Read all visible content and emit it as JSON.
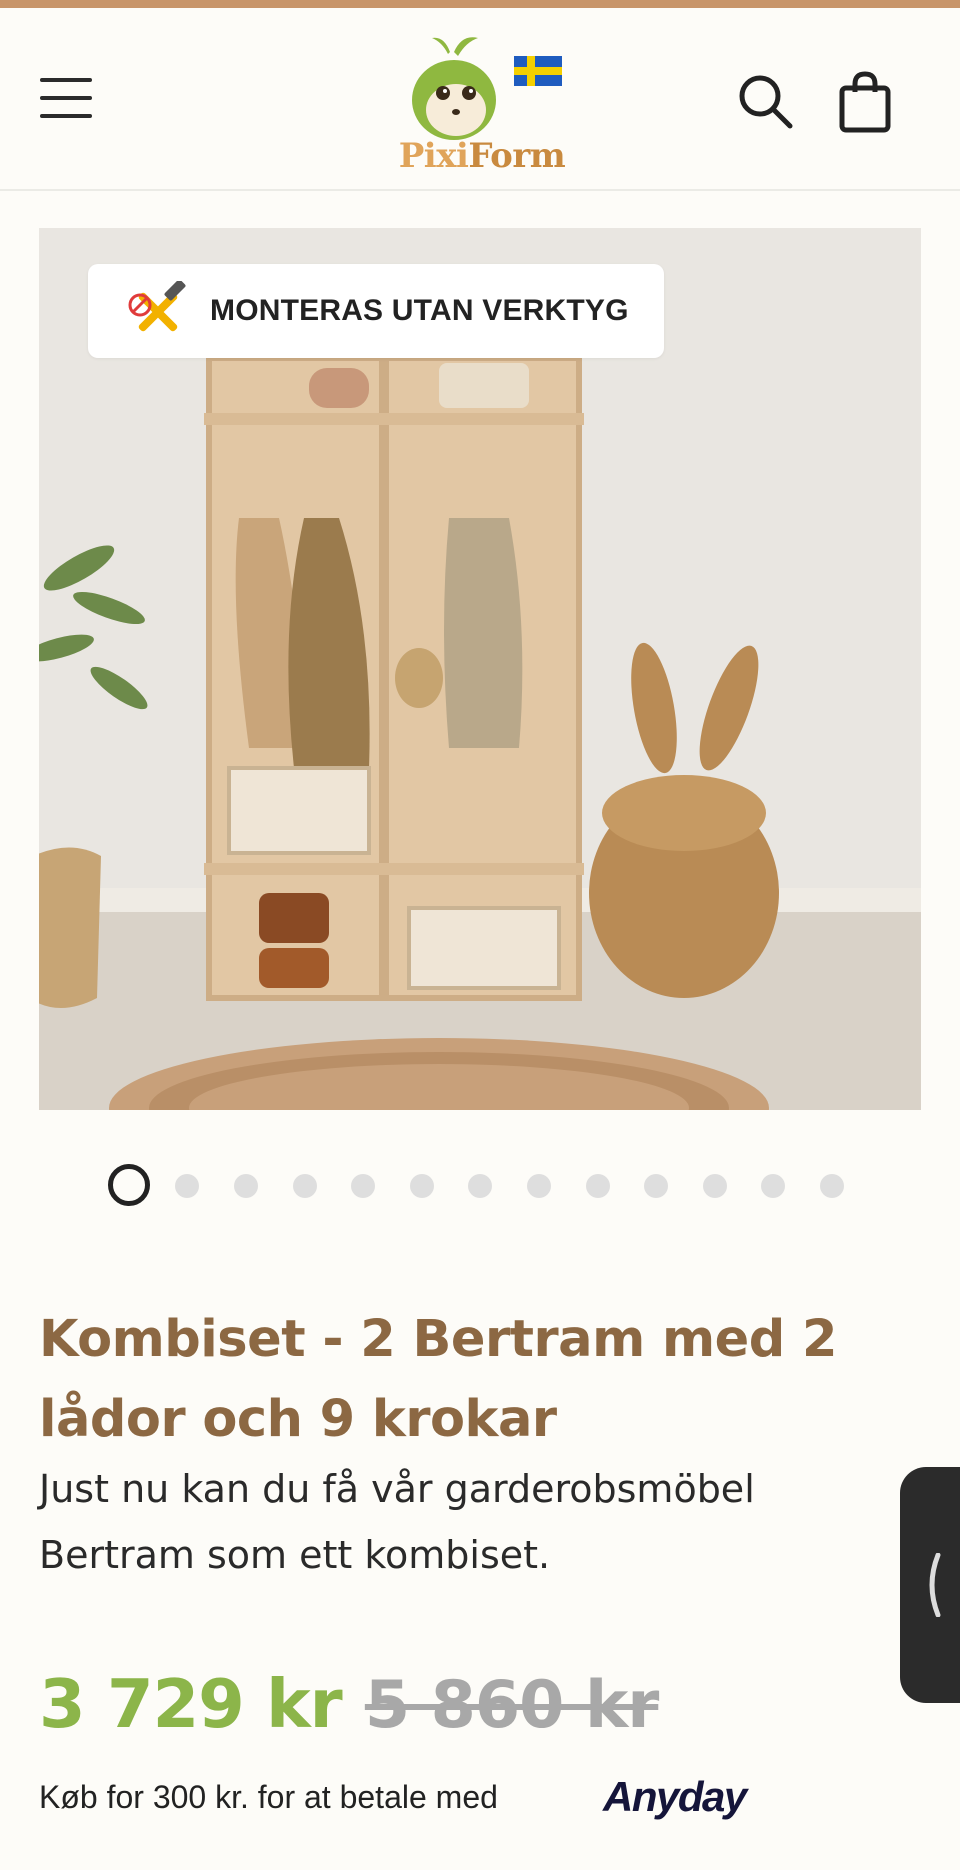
{
  "header": {
    "menu_icon": "hamburger-menu-icon",
    "logo_text_part1": "Pixi",
    "logo_text_part2": "Form",
    "flag_icon": "swedish-flag-icon",
    "search_icon": "search-icon",
    "cart_icon": "shopping-bag-icon",
    "accent_color": "#c8956a"
  },
  "hero": {
    "badge_text": "MONTERAS UTAN VERKTYG",
    "badge_icon": "no-tools-icon"
  },
  "carousel": {
    "dot_count": 13,
    "active_index": 0
  },
  "product": {
    "title_line1": "Kombiset - 2 Bertram med 2",
    "title_line2": "lådor och 9 krokar",
    "description_line1": "Just nu kan du få vår garderobsmöbel",
    "description_line2": "Bertram som ett kombiset.",
    "price": "3 729 kr",
    "original_price": "5 860 kr",
    "price_color": "#8cb54a",
    "title_color": "#8c6843"
  },
  "payment": {
    "text": "Køb for 300 kr. for at betale med",
    "provider": "Anyday"
  },
  "side_tab": {
    "icon": "chevron-left-icon"
  }
}
